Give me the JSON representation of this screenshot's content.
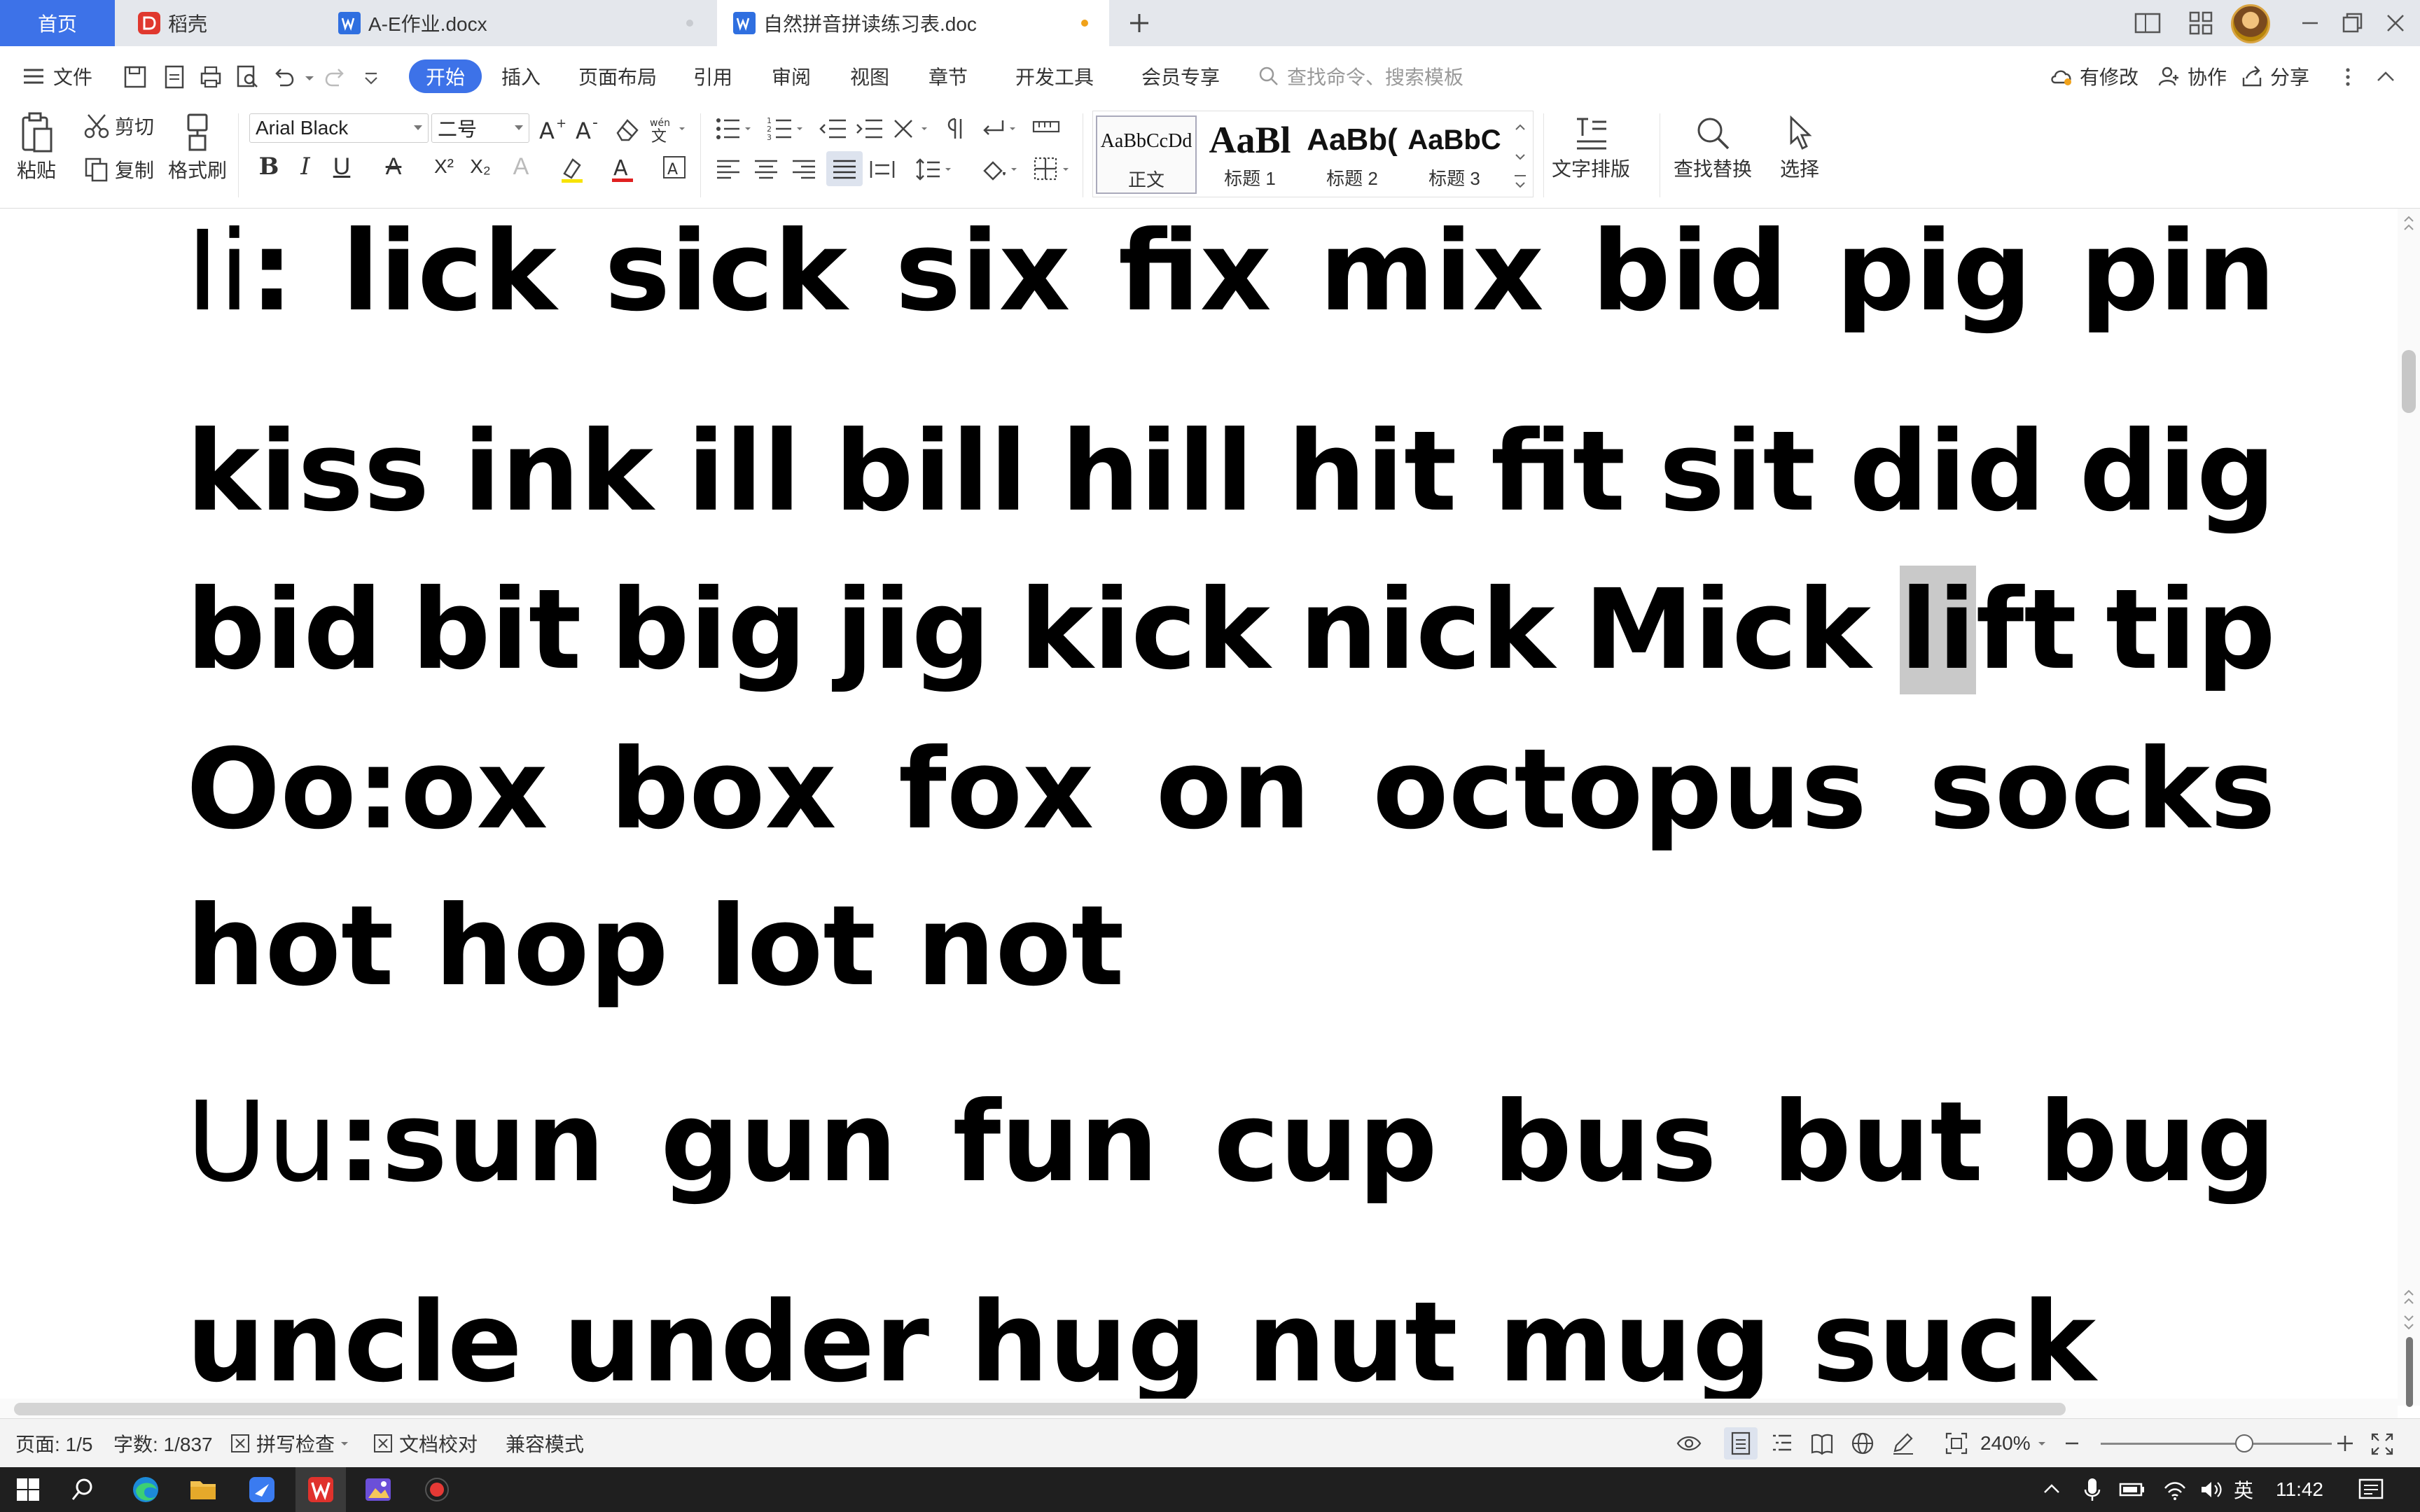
{
  "tabs": {
    "home": "首页",
    "daoke": "稻壳",
    "doc1": "A-E作业.docx",
    "doc2": "自然拼音拼读练习表.doc",
    "new_tab": "+"
  },
  "menu": {
    "file": "文件",
    "items": [
      "开始",
      "插入",
      "页面布局",
      "引用",
      "审阅",
      "视图",
      "章节",
      "开发工具",
      "会员专享"
    ],
    "search_placeholder": "查找命令、搜索模板",
    "modified": "有修改",
    "collab": "协作",
    "share": "分享"
  },
  "ribbon": {
    "paste": "粘贴",
    "cut": "剪切",
    "copy": "复制",
    "format_painter": "格式刷",
    "font_name": "Arial Black",
    "font_size": "二号",
    "styles": [
      {
        "preview": "AaBbCcDd",
        "label": "正文"
      },
      {
        "preview": "AaBl",
        "label": "标题 1"
      },
      {
        "preview": "AaBb(",
        "label": "标题 2"
      },
      {
        "preview": "AaBbC",
        "label": "标题 3"
      }
    ],
    "text_layout": "文字排版",
    "find_replace": "查找替换",
    "select": "选择"
  },
  "document": {
    "lines": [
      {
        "prefix": "Ii",
        "words": [
          "lick",
          "sick",
          "six",
          "fix",
          "mix",
          "bid",
          "pig",
          "pin"
        ]
      },
      {
        "words": [
          "kiss",
          "ink",
          "ill",
          "bill",
          "hill",
          "hit",
          "fit",
          "sit",
          "did",
          "dig"
        ]
      },
      {
        "words": [
          "bid",
          "bit",
          "big",
          "jig",
          "kick",
          "nick",
          "Mick",
          "lift",
          "tip"
        ]
      },
      {
        "words": [
          "Oo:ox",
          "box",
          "fox",
          "on",
          "octopus",
          "socks"
        ]
      },
      {
        "words": [
          "hot",
          "hop",
          "lot",
          "not"
        ]
      },
      {
        "prefix": "Uu",
        "words": [
          ":sun",
          "gun",
          "fun",
          "cup",
          "bus",
          "but",
          "bug"
        ]
      },
      {
        "words": [
          "uncle",
          "under",
          "hug",
          "nut",
          "mug",
          "suck"
        ]
      }
    ],
    "colon": ":",
    "lift_highlight": "li",
    "lift_rest": "ft"
  },
  "status": {
    "page": "页面: 1/5",
    "words": "字数: 1/837",
    "spell": "拼写检查",
    "proof": "文档校对",
    "compat": "兼容模式",
    "zoom": "240%"
  },
  "taskbar": {
    "ime": "英",
    "time": "11:42"
  },
  "colors": {
    "accent": "#3d72e8",
    "modified_dot": "#f0a21a",
    "highlight": "#c9c9c9"
  }
}
